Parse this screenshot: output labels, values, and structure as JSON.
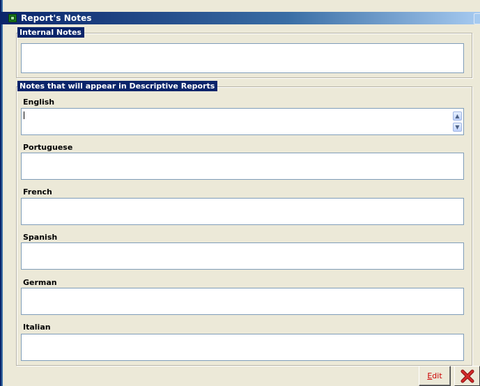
{
  "window": {
    "title": "Report's Notes"
  },
  "internal_notes": {
    "label": "Internal Notes",
    "value": ""
  },
  "descriptive_notes": {
    "label": "Notes that will appear in Descriptive Reports",
    "fields": [
      {
        "label": "English",
        "value": ""
      },
      {
        "label": "Portuguese",
        "value": ""
      },
      {
        "label": "French",
        "value": ""
      },
      {
        "label": "Spanish",
        "value": ""
      },
      {
        "label": "German",
        "value": ""
      },
      {
        "label": "Italian",
        "value": ""
      }
    ]
  },
  "toolbar": {
    "edit_label_accel": "E",
    "edit_label_rest": "dit"
  },
  "icons": {
    "close": "close-x-icon",
    "app": "app-window-icon"
  },
  "colors": {
    "section_label_bg": "#0a246a",
    "edit_text": "#cc0000",
    "close_red": "#d22a2a"
  }
}
